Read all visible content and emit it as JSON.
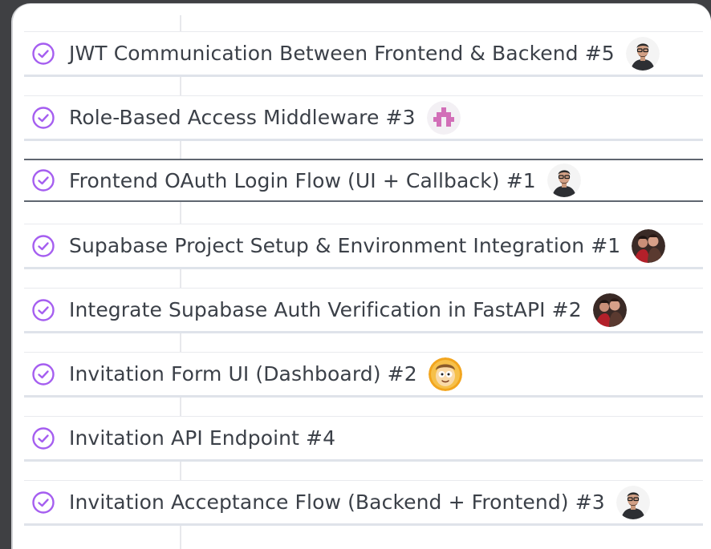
{
  "tasks": [
    {
      "title": "JWT Communication Between Frontend & Backend #5",
      "avatar": "man-glasses-avatar-icon",
      "selected": false
    },
    {
      "title": "Role-Based Access Middleware #3",
      "avatar": "pink-identicon-avatar-icon",
      "selected": false
    },
    {
      "title": "Frontend OAuth Login Flow (UI + Callback) #1",
      "avatar": "man-glasses-avatar-icon",
      "selected": true
    },
    {
      "title": "Supabase Project Setup & Environment Integration #1",
      "avatar": "group-photo-avatar-icon",
      "selected": false
    },
    {
      "title": "Integrate Supabase Auth Verification in FastAPI #2",
      "avatar": "group-photo-avatar-icon",
      "selected": false
    },
    {
      "title": "Invitation Form UI (Dashboard) #2",
      "avatar": "cartoon-character-avatar-icon",
      "selected": false
    },
    {
      "title": "Invitation API Endpoint #4",
      "avatar": null,
      "selected": false
    },
    {
      "title": "Invitation Acceptance Flow (Backend + Frontend) #3",
      "avatar": "man-glasses-avatar-icon",
      "selected": false
    }
  ],
  "colors": {
    "check_icon": "#a55ef0",
    "text": "#3b4048",
    "card_shadow": "#dfe3ea",
    "background": "#3f4043"
  }
}
